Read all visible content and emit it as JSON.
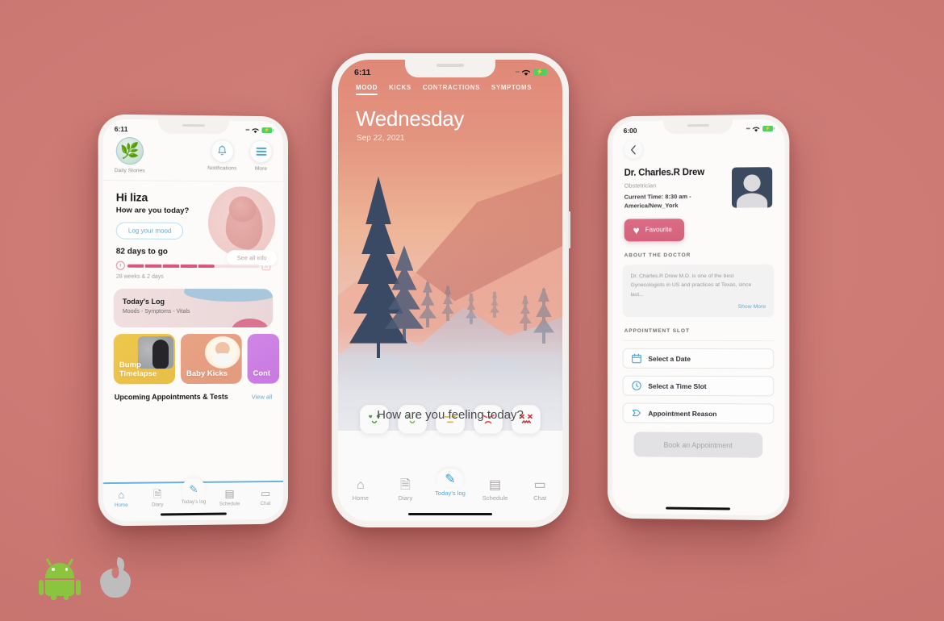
{
  "background_color": "#cd7974",
  "left_phone": {
    "status": {
      "time": "6:11",
      "wifi_icon": "wifi-icon",
      "battery_icon": "battery-charging-icon"
    },
    "header": {
      "stories_label": "Daily Stories",
      "stories_icon": "monstera-leaf-icon",
      "notifications_label": "Notifications",
      "notifications_icon": "bell-icon",
      "more_label": "More",
      "more_icon": "hamburger-menu-icon"
    },
    "greeting": {
      "name": "Hi liza",
      "question": "How are you today?",
      "mood_button": "Log your mood",
      "see_all": "See all info"
    },
    "progress": {
      "days_to_go": "82 days to go",
      "weeks": "28 weeks & 2 days",
      "percent": 66,
      "start_icon": "stopwatch-icon",
      "end_icon": "baby-feet-icon"
    },
    "log_card": {
      "title": "Today's Log",
      "subtitle": "Moods - Symptoms - Vitals"
    },
    "tiles": [
      {
        "label": "Bump Timelapse",
        "color": "#efc74e"
      },
      {
        "label": "Baby Kicks",
        "color": "#e8a284"
      },
      {
        "label": "Cont",
        "color": "#cf86e6"
      }
    ],
    "upcoming": {
      "title": "Upcoming Appointments & Tests",
      "link": "View all"
    },
    "tabs": [
      {
        "label": "Home",
        "icon": "home-icon",
        "active": true
      },
      {
        "label": "Diary",
        "icon": "document-icon",
        "active": false
      },
      {
        "label": "Today's log",
        "icon": "pencil-icon",
        "active": true
      },
      {
        "label": "Schedule",
        "icon": "calendar-icon",
        "active": false
      },
      {
        "label": "Chat",
        "icon": "chat-bubble-icon",
        "active": false
      }
    ]
  },
  "center_phone": {
    "status": {
      "time": "6:11",
      "wifi_icon": "wifi-icon",
      "battery_icon": "battery-charging-icon"
    },
    "tabs": [
      {
        "label": "MOOD",
        "active": true
      },
      {
        "label": "KICKS",
        "active": false
      },
      {
        "label": "CONTRACTIONS",
        "active": false
      },
      {
        "label": "SYMPTOMS",
        "active": false
      }
    ],
    "day": "Wednesday",
    "date": "Sep 22, 2021",
    "question": "How are you feeling today?",
    "moods": [
      {
        "name": "mood-in-love",
        "glyph": "◡",
        "eyes": "♥ ♥",
        "color": "#5aa84e"
      },
      {
        "name": "mood-happy",
        "glyph": "◡",
        "eyes": "୨ ୧",
        "color": "#7bbf5e"
      },
      {
        "name": "mood-neutral",
        "glyph": "—",
        "eyes": "— —",
        "color": "#d9b847"
      },
      {
        "name": "mood-angry",
        "glyph": "◠",
        "eyes": "╲ ╱",
        "color": "#d95f5f"
      },
      {
        "name": "mood-sick",
        "glyph": "∿",
        "eyes": "✖ ✖",
        "color": "#c43a3a"
      }
    ],
    "tabs_bottom": [
      {
        "label": "Home",
        "icon": "home-icon",
        "active": false
      },
      {
        "label": "Diary",
        "icon": "document-icon",
        "active": false
      },
      {
        "label": "Today's log",
        "icon": "pencil-icon",
        "active": true
      },
      {
        "label": "Schedule",
        "icon": "calendar-icon",
        "active": false
      },
      {
        "label": "Chat",
        "icon": "chat-bubble-icon",
        "active": false
      }
    ]
  },
  "right_phone": {
    "status": {
      "time": "6:00",
      "wifi_icon": "wifi-icon",
      "battery_icon": "battery-charging-icon"
    },
    "back_icon": "chevron-left-icon",
    "doctor": {
      "name": "Dr. Charles.R Drew",
      "role": "Obstetrician",
      "current_time": "Current Time: 8:30 am - America/New_York",
      "avatar_icon": "user-avatar-icon"
    },
    "favourite_button": {
      "label": "Favourite",
      "icon": "heart-icon",
      "color": "#d4627d"
    },
    "about": {
      "section_title": "ABOUT THE DOCTOR",
      "text": "Dr. Charles.R Drew M.D. is one of the best Gynecologists in US and practices at Texas, since last...",
      "show_more": "Show More"
    },
    "appointment": {
      "section_title": "APPOINTMENT SLOT",
      "fields": [
        {
          "label": "Select a Date",
          "icon": "calendar-icon"
        },
        {
          "label": "Select a Time Slot",
          "icon": "clock-icon"
        },
        {
          "label": "Appointment Reason",
          "icon": "tag-icon"
        }
      ],
      "book_button": "Book an Appointment"
    }
  },
  "platform_logos": [
    {
      "name": "android-logo",
      "color": "#8bc53f"
    },
    {
      "name": "apple-logo",
      "color": "#bdbdbd"
    }
  ]
}
